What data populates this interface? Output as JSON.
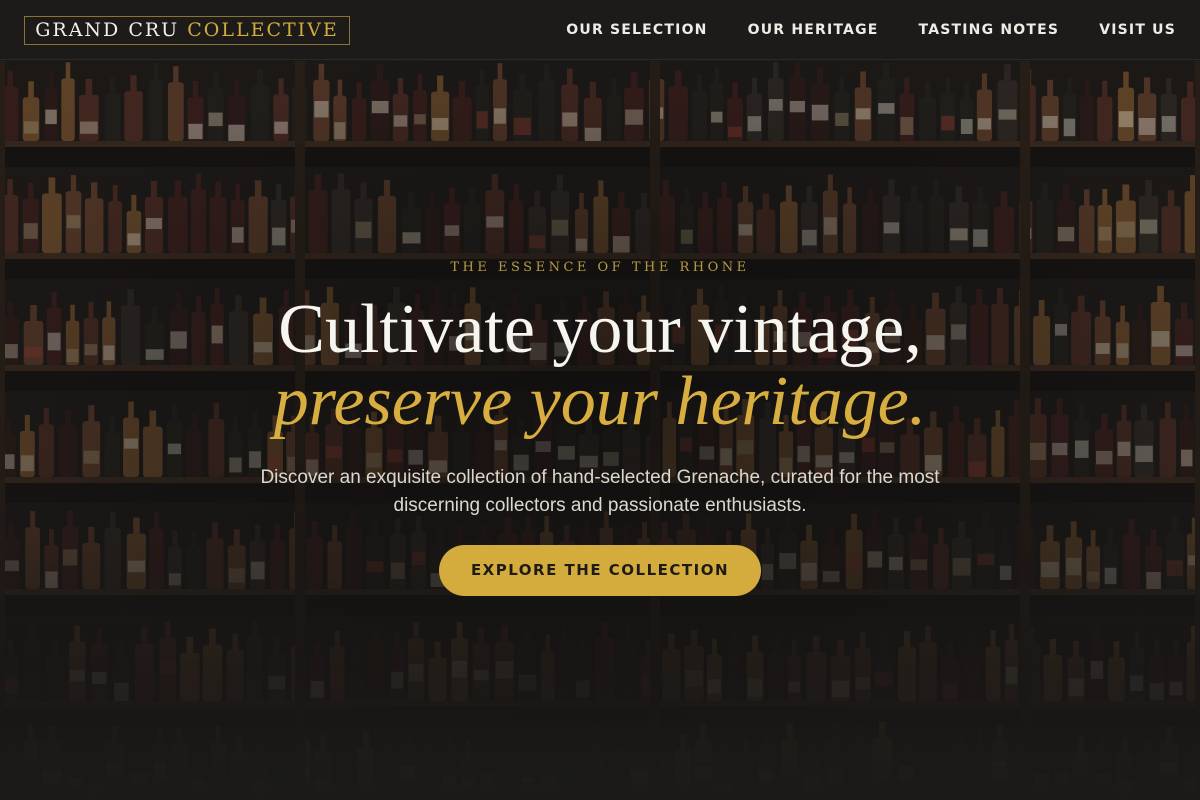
{
  "header": {
    "logo_part1": "GRAND CRU",
    "logo_part2": "COLLECTIVE",
    "nav": [
      {
        "label": "OUR SELECTION"
      },
      {
        "label": "OUR HERITAGE"
      },
      {
        "label": "TASTING NOTES"
      },
      {
        "label": "VISIT US"
      }
    ]
  },
  "hero": {
    "eyebrow": "THE ESSENCE OF THE RHONE",
    "title_line1": "Cultivate your vintage,",
    "title_line2": "preserve your heritage.",
    "subtitle": "Discover an exquisite collection of hand-selected Grenache, curated for the most discerning collectors and passionate enthusiasts.",
    "cta_label": "EXPLORE THE COLLECTION",
    "background_image": "wine-cellar-shelves-photo"
  },
  "colors": {
    "background": "#1b1a19",
    "accent_gold": "#d4ac3d",
    "text_light": "#f7f5ef"
  }
}
